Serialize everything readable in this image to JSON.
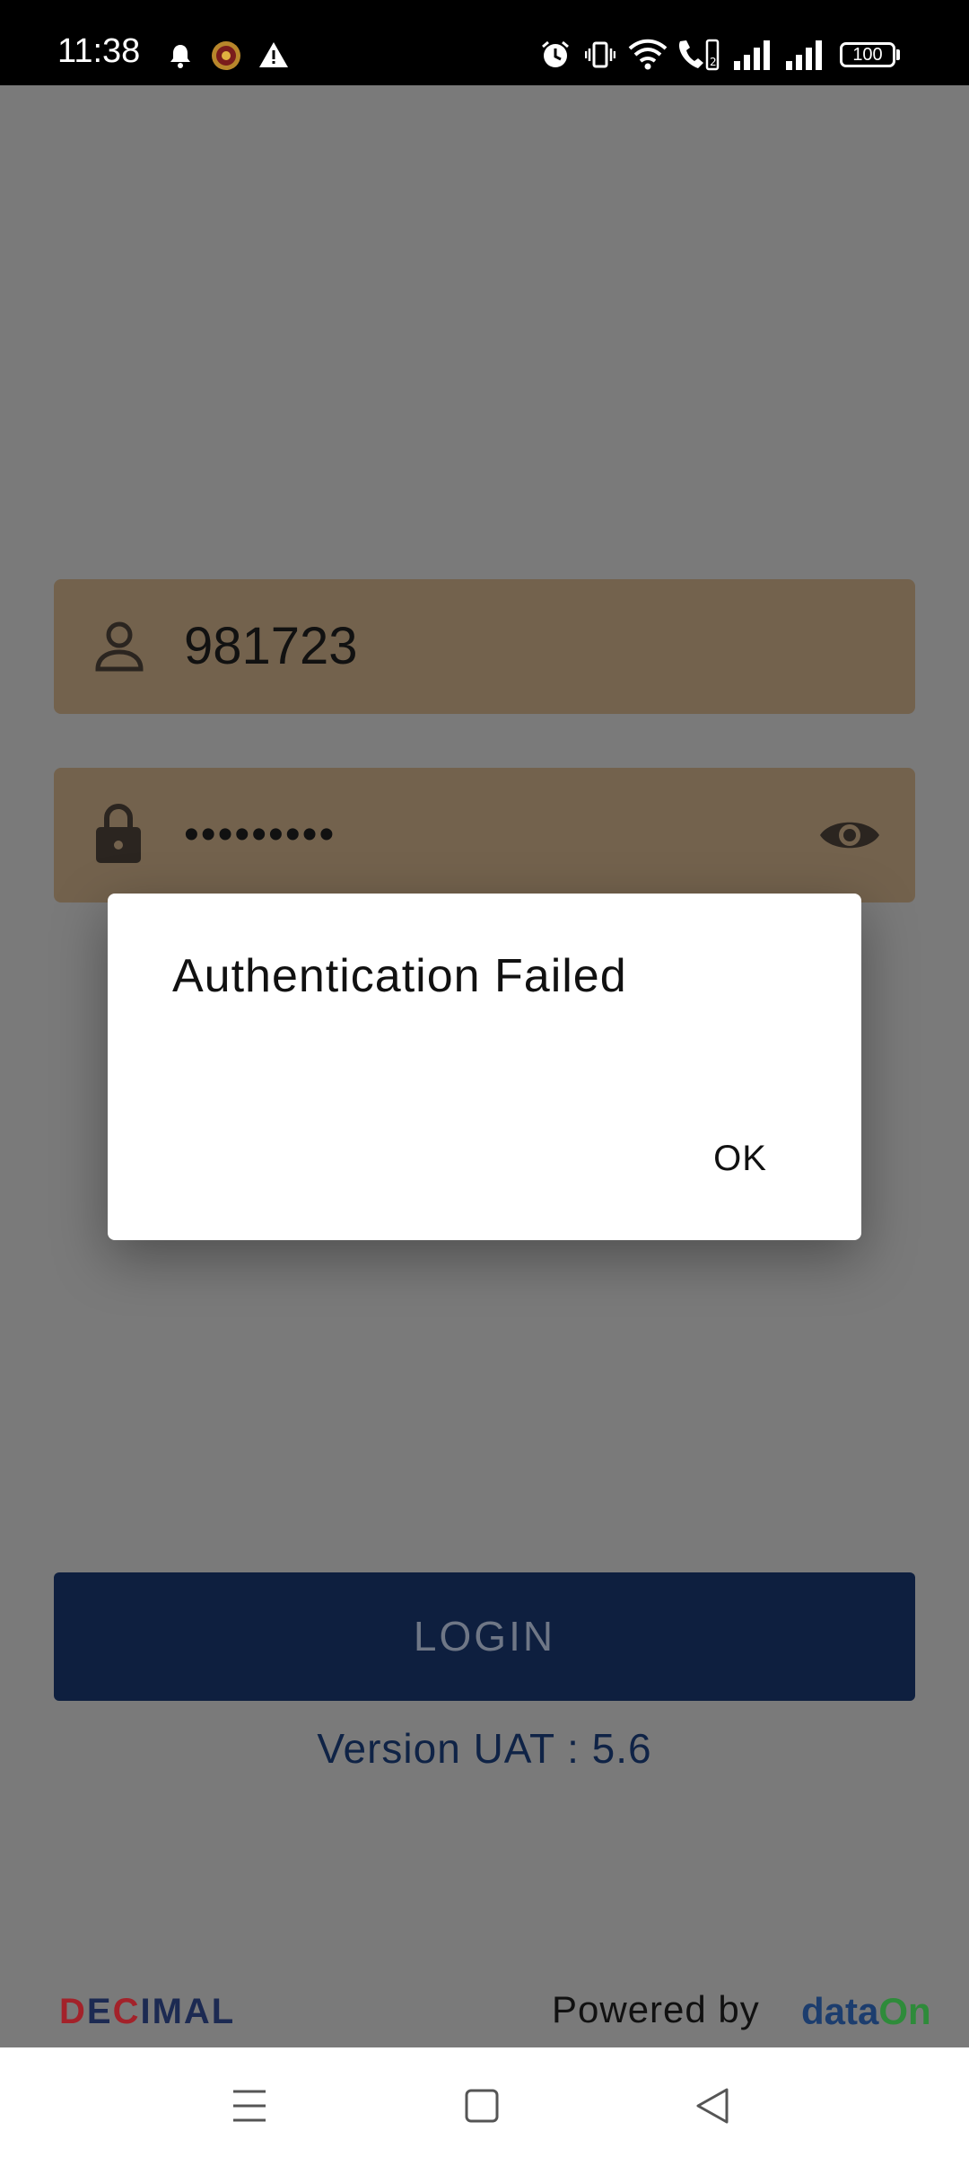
{
  "status_bar": {
    "time": "11:38",
    "battery": "100",
    "icons": [
      "notification-bell-icon",
      "app-badge-icon",
      "warning-icon",
      "alarm-icon",
      "vibrate-icon",
      "wifi-icon",
      "wifi-calling-icon",
      "signal-1-icon",
      "signal-2-icon",
      "battery-icon"
    ]
  },
  "login_form": {
    "username_value": "981723",
    "password_value": "•••••••••",
    "username_icon": "person-icon",
    "password_icon": "lock-icon",
    "show_password_icon": "eye-icon",
    "login_label": "LOGIN",
    "version_text": "Version UAT : 5.6"
  },
  "footer": {
    "decimal_logo_part1": "D",
    "decimal_logo_part2": "E",
    "decimal_logo_part3": "C",
    "decimal_logo_part4": "IMAL",
    "powered_by": "Powered by",
    "dataon_logo_part1": "data",
    "dataon_logo_part2": "On"
  },
  "dialog": {
    "title": "Authentication Failed",
    "ok_label": "OK"
  },
  "nav_bar": {
    "icons": [
      "menu-icon",
      "home-icon",
      "back-icon"
    ]
  },
  "colors": {
    "field_bg": "#73624d",
    "login_bg": "#0e1f3f",
    "overlay": "#7a7a7a",
    "brand_navy": "#1c2a52",
    "brand_red": "#a3222a",
    "brand_green": "#2e8b3a"
  }
}
